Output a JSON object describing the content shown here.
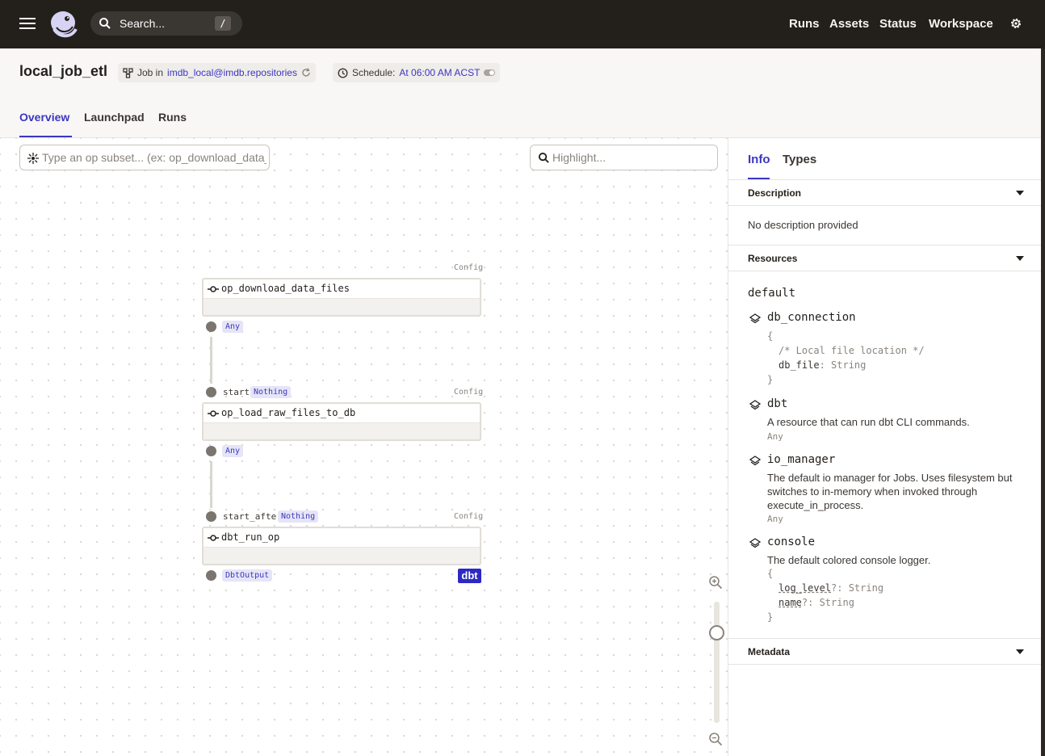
{
  "topbar": {
    "search_placeholder": "Search...",
    "search_shortcut": "/",
    "nav": [
      "Runs",
      "Assets",
      "Status",
      "Workspace"
    ]
  },
  "header": {
    "job_title": "local_job_etl",
    "job_pill_prefix": "Job in",
    "job_pill_repo": "imdb_local@imdb.repositories",
    "schedule_prefix": "Schedule:",
    "schedule_value": "At 06:00 AM ACST",
    "tabs": [
      "Overview",
      "Launchpad",
      "Runs"
    ]
  },
  "graph": {
    "op_subset_placeholder": "Type an op subset... (ex: op_download_data_files+)",
    "highlight_placeholder": "Highlight...",
    "config_label": "Config",
    "ops": [
      {
        "name": "op_download_data_files",
        "input_name": "",
        "input_type": "",
        "output_type": "Any"
      },
      {
        "name": "op_load_raw_files_to_db",
        "input_name": "start",
        "input_type": "Nothing",
        "output_type": "Any"
      },
      {
        "name": "dbt_run_op",
        "input_name": "start_after",
        "input_type": "Nothing",
        "output_type": "DbtOutput"
      }
    ],
    "kind_tag": "dbt"
  },
  "panel": {
    "tabs": [
      "Info",
      "Types"
    ],
    "description_header": "Description",
    "description_text": "No description provided",
    "resources_header": "Resources",
    "resource_group": "default",
    "resources": [
      {
        "name": "db_connection",
        "desc": "",
        "type": ""
      },
      {
        "name": "dbt",
        "desc": "A resource that can run dbt CLI commands.",
        "type": "Any"
      },
      {
        "name": "io_manager",
        "desc": "The default io manager for Jobs. Uses filesystem but switches to in-memory when invoked through execute_in_process.",
        "type": "Any"
      },
      {
        "name": "console",
        "desc": "The default colored console logger.",
        "type": ""
      }
    ],
    "db_connection_config": {
      "open": "{",
      "comment": "/* Local file location */",
      "key": "db_file",
      "type": ": String",
      "close": "}"
    },
    "console_config": {
      "open": "{",
      "key1": "log_level",
      "type1": "?: String",
      "key2": "name",
      "type2": "?: String",
      "close": "}"
    },
    "metadata_header": "Metadata"
  },
  "colors": {
    "accent": "#3b37c1",
    "topbar_bg": "#231f1b",
    "dbt_tag": "#2c29c4"
  }
}
